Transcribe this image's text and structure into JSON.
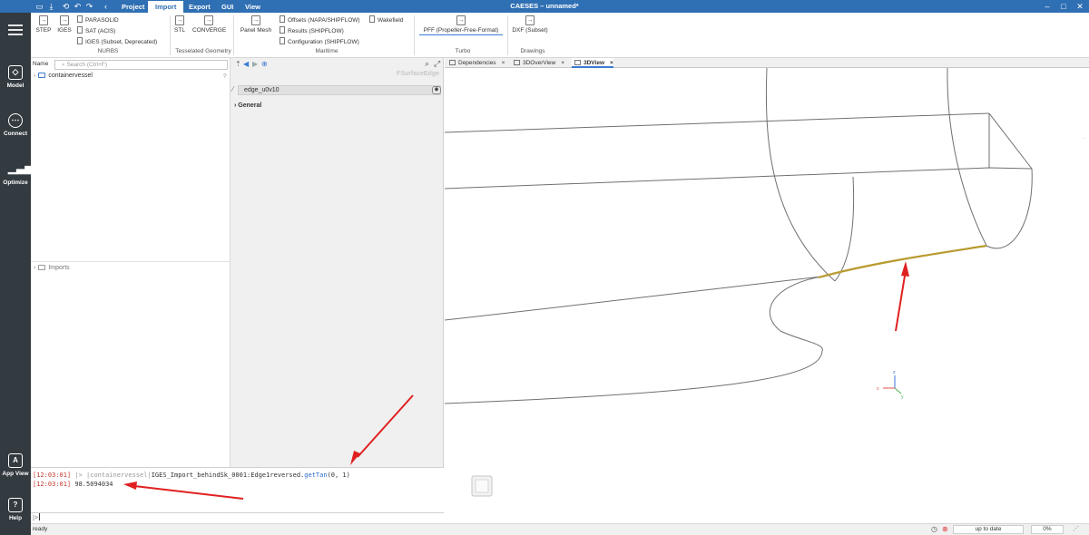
{
  "window": {
    "title": "CAESES – unnamed*",
    "menu_tabs": [
      "Project",
      "Import",
      "Export",
      "GUI",
      "View"
    ],
    "active_tab": "Import",
    "controls": [
      "–",
      "□",
      "✕"
    ]
  },
  "ribbon": {
    "step_label": "STEP",
    "iges_label": "IGES",
    "nurbs_items": [
      "PARASOLID",
      "SAT (ACIS)",
      "IGES (Subset, Deprecated)"
    ],
    "nurbs_group": "NURBS",
    "stl_label": "STL",
    "converge_label": "CONVERGE",
    "tess_group": "Tesselated Geometry",
    "panel_mesh_label": "Panel Mesh",
    "shipflow_items": [
      "Offsets (NAPA/SHIPFLOW)",
      "Results (SHIPFLOW)",
      "Configuration (SHIPFLOW)"
    ],
    "wakefield_label": "Wakefield",
    "maritime_group": "Maritime",
    "pff_label": "PFF (Propeller-Free-Format)",
    "turbo_group": "Turbo",
    "dxf_label": "DXF (Subset)",
    "drawings_group": "Drawings"
  },
  "sidebar": {
    "items": [
      "Model",
      "Connect",
      "Optimize",
      "App View",
      "Help"
    ]
  },
  "tree": {
    "name_label": "Name",
    "search_placeholder": "Search (Ctrl+F)",
    "root_item": "containervessel",
    "help_mark": "?",
    "imports_item": "Imports"
  },
  "properties": {
    "type_label": "FSurfaceEdge",
    "object_name": "edge_u0v10",
    "section": "General"
  },
  "viewer": {
    "tabs": [
      "Dependencies",
      "3DOverView",
      "3DView"
    ],
    "active_tab": "3DView",
    "axis_labels": [
      "z",
      "x",
      "y"
    ]
  },
  "console": {
    "lines": [
      {
        "time": "[12:03:01]",
        "prompt": "|>",
        "text_parts": [
          "|containervessel|",
          "IGES_Import_behindSk_0001:Edge1reversed.",
          "getTan",
          "(0, 1)"
        ]
      },
      {
        "time": "[12:03:01]",
        "value": "98.5094034"
      }
    ],
    "input_prompt": "|>"
  },
  "status": {
    "left": "ready",
    "update": "up to date",
    "percent": "0%"
  },
  "colors": {
    "accent": "#2f6fb3",
    "sidebar": "#333a40",
    "highlight_edge": "#b89a2e",
    "annotation_arrow": "#e02020"
  }
}
